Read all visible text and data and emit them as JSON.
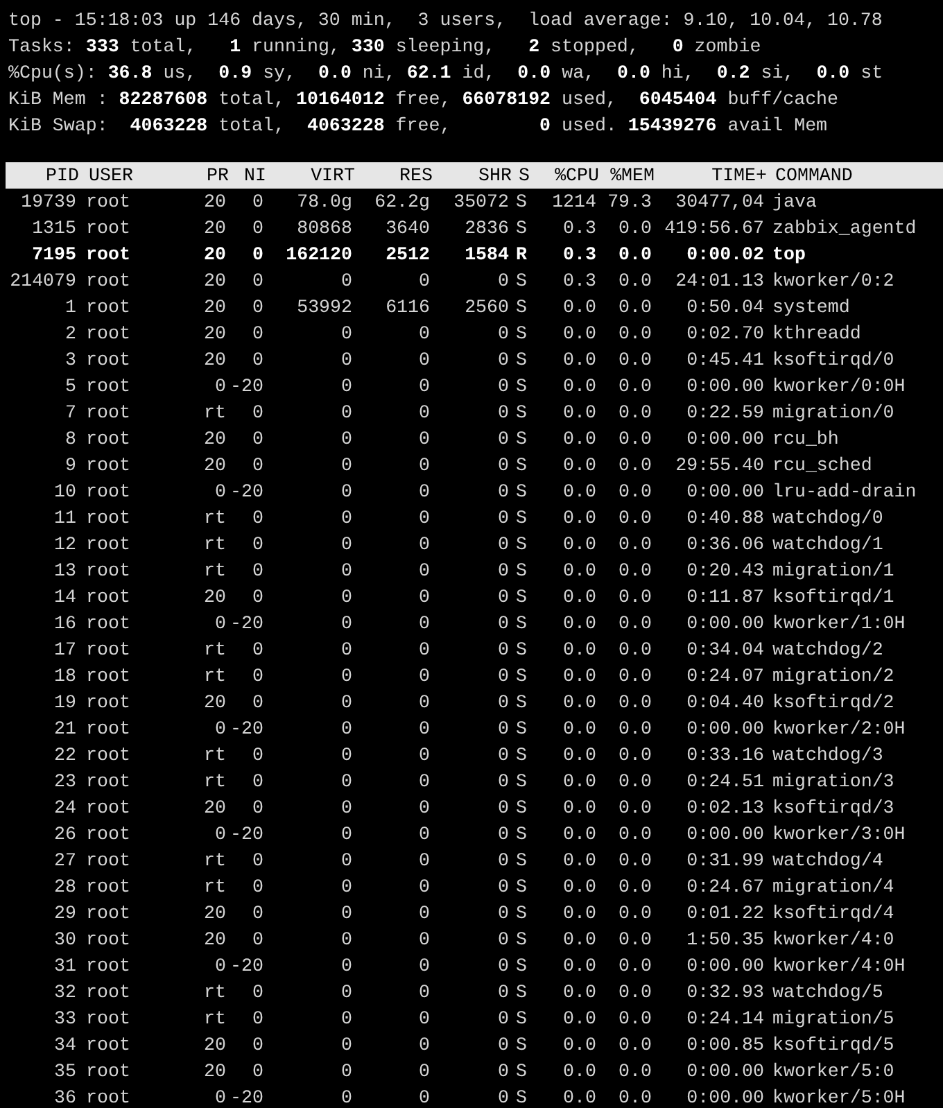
{
  "summary": [
    "top - 15:18:03 up 146 days, 30 min,  3 users,  load average: 9.10, 10.04, 10.78",
    "Tasks: **333** total,   **1** running, **330** sleeping,   **2** stopped,   **0** zombie",
    "%Cpu(s): **36.8** us,  **0.9** sy,  **0.0** ni, **62.1** id,  **0.0** wa,  **0.0** hi,  **0.2** si,  **0.0** st",
    "KiB Mem : **82287608** total, **10164012** free, **66078192** used,  **6045404** buff/cache",
    "KiB Swap:  **4063228** total,  **4063228** free,        **0** used. **15439276** avail Mem"
  ],
  "table": {
    "columns": [
      "PID",
      "USER",
      "PR",
      "NI",
      "VIRT",
      "RES",
      "SHR",
      "S",
      "%CPU",
      "%MEM",
      "TIME+",
      "COMMAND"
    ],
    "rows": [
      {
        "highlighted": false,
        "cells": [
          "19739",
          "root",
          "20",
          "0",
          "78.0g",
          "62.2g",
          "35072",
          "S",
          "1214",
          "79.3",
          "30477,04",
          "java"
        ]
      },
      {
        "highlighted": false,
        "cells": [
          "1315",
          "root",
          "20",
          "0",
          "80868",
          "3640",
          "2836",
          "S",
          "0.3",
          "0.0",
          "419:56.67",
          "zabbix_agentd"
        ]
      },
      {
        "highlighted": true,
        "cells": [
          "7195",
          "root",
          "20",
          "0",
          "162120",
          "2512",
          "1584",
          "R",
          "0.3",
          "0.0",
          "0:00.02",
          "top"
        ]
      },
      {
        "highlighted": false,
        "cells": [
          "214079",
          "root",
          "20",
          "0",
          "0",
          "0",
          "0",
          "S",
          "0.3",
          "0.0",
          "24:01.13",
          "kworker/0:2"
        ]
      },
      {
        "highlighted": false,
        "cells": [
          "1",
          "root",
          "20",
          "0",
          "53992",
          "6116",
          "2560",
          "S",
          "0.0",
          "0.0",
          "0:50.04",
          "systemd"
        ]
      },
      {
        "highlighted": false,
        "cells": [
          "2",
          "root",
          "20",
          "0",
          "0",
          "0",
          "0",
          "S",
          "0.0",
          "0.0",
          "0:02.70",
          "kthreadd"
        ]
      },
      {
        "highlighted": false,
        "cells": [
          "3",
          "root",
          "20",
          "0",
          "0",
          "0",
          "0",
          "S",
          "0.0",
          "0.0",
          "0:45.41",
          "ksoftirqd/0"
        ]
      },
      {
        "highlighted": false,
        "cells": [
          "5",
          "root",
          "0",
          "-20",
          "0",
          "0",
          "0",
          "S",
          "0.0",
          "0.0",
          "0:00.00",
          "kworker/0:0H"
        ]
      },
      {
        "highlighted": false,
        "cells": [
          "7",
          "root",
          "rt",
          "0",
          "0",
          "0",
          "0",
          "S",
          "0.0",
          "0.0",
          "0:22.59",
          "migration/0"
        ]
      },
      {
        "highlighted": false,
        "cells": [
          "8",
          "root",
          "20",
          "0",
          "0",
          "0",
          "0",
          "S",
          "0.0",
          "0.0",
          "0:00.00",
          "rcu_bh"
        ]
      },
      {
        "highlighted": false,
        "cells": [
          "9",
          "root",
          "20",
          "0",
          "0",
          "0",
          "0",
          "S",
          "0.0",
          "0.0",
          "29:55.40",
          "rcu_sched"
        ]
      },
      {
        "highlighted": false,
        "cells": [
          "10",
          "root",
          "0",
          "-20",
          "0",
          "0",
          "0",
          "S",
          "0.0",
          "0.0",
          "0:00.00",
          "lru-add-drain"
        ]
      },
      {
        "highlighted": false,
        "cells": [
          "11",
          "root",
          "rt",
          "0",
          "0",
          "0",
          "0",
          "S",
          "0.0",
          "0.0",
          "0:40.88",
          "watchdog/0"
        ]
      },
      {
        "highlighted": false,
        "cells": [
          "12",
          "root",
          "rt",
          "0",
          "0",
          "0",
          "0",
          "S",
          "0.0",
          "0.0",
          "0:36.06",
          "watchdog/1"
        ]
      },
      {
        "highlighted": false,
        "cells": [
          "13",
          "root",
          "rt",
          "0",
          "0",
          "0",
          "0",
          "S",
          "0.0",
          "0.0",
          "0:20.43",
          "migration/1"
        ]
      },
      {
        "highlighted": false,
        "cells": [
          "14",
          "root",
          "20",
          "0",
          "0",
          "0",
          "0",
          "S",
          "0.0",
          "0.0",
          "0:11.87",
          "ksoftirqd/1"
        ]
      },
      {
        "highlighted": false,
        "cells": [
          "16",
          "root",
          "0",
          "-20",
          "0",
          "0",
          "0",
          "S",
          "0.0",
          "0.0",
          "0:00.00",
          "kworker/1:0H"
        ]
      },
      {
        "highlighted": false,
        "cells": [
          "17",
          "root",
          "rt",
          "0",
          "0",
          "0",
          "0",
          "S",
          "0.0",
          "0.0",
          "0:34.04",
          "watchdog/2"
        ]
      },
      {
        "highlighted": false,
        "cells": [
          "18",
          "root",
          "rt",
          "0",
          "0",
          "0",
          "0",
          "S",
          "0.0",
          "0.0",
          "0:24.07",
          "migration/2"
        ]
      },
      {
        "highlighted": false,
        "cells": [
          "19",
          "root",
          "20",
          "0",
          "0",
          "0",
          "0",
          "S",
          "0.0",
          "0.0",
          "0:04.40",
          "ksoftirqd/2"
        ]
      },
      {
        "highlighted": false,
        "cells": [
          "21",
          "root",
          "0",
          "-20",
          "0",
          "0",
          "0",
          "S",
          "0.0",
          "0.0",
          "0:00.00",
          "kworker/2:0H"
        ]
      },
      {
        "highlighted": false,
        "cells": [
          "22",
          "root",
          "rt",
          "0",
          "0",
          "0",
          "0",
          "S",
          "0.0",
          "0.0",
          "0:33.16",
          "watchdog/3"
        ]
      },
      {
        "highlighted": false,
        "cells": [
          "23",
          "root",
          "rt",
          "0",
          "0",
          "0",
          "0",
          "S",
          "0.0",
          "0.0",
          "0:24.51",
          "migration/3"
        ]
      },
      {
        "highlighted": false,
        "cells": [
          "24",
          "root",
          "20",
          "0",
          "0",
          "0",
          "0",
          "S",
          "0.0",
          "0.0",
          "0:02.13",
          "ksoftirqd/3"
        ]
      },
      {
        "highlighted": false,
        "cells": [
          "26",
          "root",
          "0",
          "-20",
          "0",
          "0",
          "0",
          "S",
          "0.0",
          "0.0",
          "0:00.00",
          "kworker/3:0H"
        ]
      },
      {
        "highlighted": false,
        "cells": [
          "27",
          "root",
          "rt",
          "0",
          "0",
          "0",
          "0",
          "S",
          "0.0",
          "0.0",
          "0:31.99",
          "watchdog/4"
        ]
      },
      {
        "highlighted": false,
        "cells": [
          "28",
          "root",
          "rt",
          "0",
          "0",
          "0",
          "0",
          "S",
          "0.0",
          "0.0",
          "0:24.67",
          "migration/4"
        ]
      },
      {
        "highlighted": false,
        "cells": [
          "29",
          "root",
          "20",
          "0",
          "0",
          "0",
          "0",
          "S",
          "0.0",
          "0.0",
          "0:01.22",
          "ksoftirqd/4"
        ]
      },
      {
        "highlighted": false,
        "cells": [
          "30",
          "root",
          "20",
          "0",
          "0",
          "0",
          "0",
          "S",
          "0.0",
          "0.0",
          "1:50.35",
          "kworker/4:0"
        ]
      },
      {
        "highlighted": false,
        "cells": [
          "31",
          "root",
          "0",
          "-20",
          "0",
          "0",
          "0",
          "S",
          "0.0",
          "0.0",
          "0:00.00",
          "kworker/4:0H"
        ]
      },
      {
        "highlighted": false,
        "cells": [
          "32",
          "root",
          "rt",
          "0",
          "0",
          "0",
          "0",
          "S",
          "0.0",
          "0.0",
          "0:32.93",
          "watchdog/5"
        ]
      },
      {
        "highlighted": false,
        "cells": [
          "33",
          "root",
          "rt",
          "0",
          "0",
          "0",
          "0",
          "S",
          "0.0",
          "0.0",
          "0:24.14",
          "migration/5"
        ]
      },
      {
        "highlighted": false,
        "cells": [
          "34",
          "root",
          "20",
          "0",
          "0",
          "0",
          "0",
          "S",
          "0.0",
          "0.0",
          "0:00.85",
          "ksoftirqd/5"
        ]
      },
      {
        "highlighted": false,
        "cells": [
          "35",
          "root",
          "20",
          "0",
          "0",
          "0",
          "0",
          "S",
          "0.0",
          "0.0",
          "0:00.00",
          "kworker/5:0"
        ]
      },
      {
        "highlighted": false,
        "cells": [
          "36",
          "root",
          "0",
          "-20",
          "0",
          "0",
          "0",
          "S",
          "0.0",
          "0.0",
          "0:00.00",
          "kworker/5:0H"
        ]
      }
    ]
  }
}
